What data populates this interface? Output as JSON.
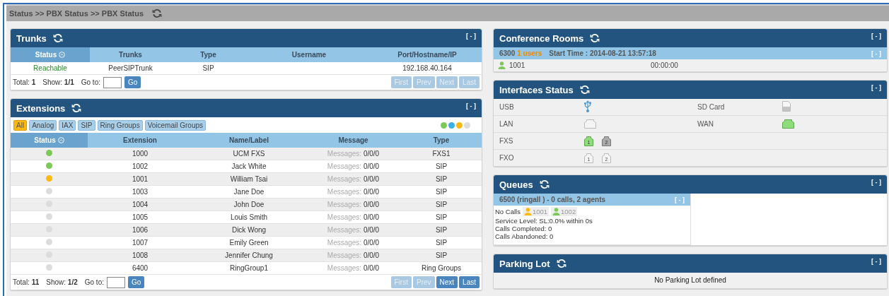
{
  "breadcrumb": "Status >> PBX Status >> PBX Status",
  "trunks": {
    "title": "Trunks",
    "collapse": "[ - ]",
    "columns": [
      {
        "label": "Status",
        "sorted": true
      },
      {
        "label": "Trunks",
        "sorted": false
      },
      {
        "label": "Type",
        "sorted": false
      },
      {
        "label": "Username",
        "sorted": false
      },
      {
        "label": "Port/Hostname/IP",
        "sorted": false
      }
    ],
    "rows": [
      {
        "status": "Reachable",
        "trunk": "PeerSIPTrunk",
        "type": "SIP",
        "host": "192.168.40.164"
      }
    ],
    "pager": {
      "total": "Total: **1**",
      "show": "Show: **1/1**",
      "goto": "Go to:",
      "go": "Go",
      "buttons": [
        {
          "label": "First",
          "disabled": true
        },
        {
          "label": "Prev",
          "disabled": true
        },
        {
          "label": "Next",
          "disabled": true
        },
        {
          "label": "Last",
          "disabled": true
        }
      ]
    }
  },
  "extensions": {
    "title": "Extensions",
    "collapse": "[ - ]",
    "filters": [
      {
        "label": "All",
        "selected": true
      },
      {
        "label": "Analog",
        "selected": false
      },
      {
        "label": "IAX",
        "selected": false
      },
      {
        "label": "SIP",
        "selected": false
      },
      {
        "label": "Ring Groups",
        "selected": false
      },
      {
        "label": "Voicemail Groups",
        "selected": false
      }
    ],
    "legend": [
      {
        "color": "#7dc957"
      },
      {
        "color": "#3bb0e6"
      },
      {
        "color": "#fdb913"
      },
      {
        "color": "#dcdcdc"
      }
    ],
    "columns": [
      {
        "label": "Status",
        "sorted": true
      },
      {
        "label": "Extension",
        "sorted": false
      },
      {
        "label": "Name/Label",
        "sorted": false
      },
      {
        "label": "Message",
        "sorted": false
      },
      {
        "label": "Type",
        "sorted": false
      }
    ],
    "rows": [
      {
        "color": "#7dc957",
        "extension": "1000",
        "name": "UCM FXS",
        "message_label": "Messages:",
        "message": "0/0/0",
        "type": "FXS1"
      },
      {
        "color": "#7dc957",
        "extension": "1002",
        "name": "Jack White",
        "message_label": "Messages:",
        "message": "0/0/0",
        "type": "SIP"
      },
      {
        "color": "#fdb913",
        "extension": "1001",
        "name": "William Tsai",
        "message_label": "Messages:",
        "message": "0/0/0",
        "type": "SIP"
      },
      {
        "color": "#dcdcdc",
        "extension": "1003",
        "name": "Jane Doe",
        "message_label": "Messages:",
        "message": "0/0/0",
        "type": "SIP"
      },
      {
        "color": "#dcdcdc",
        "extension": "1004",
        "name": "John Doe",
        "message_label": "Messages:",
        "message": "0/0/0",
        "type": "SIP"
      },
      {
        "color": "#dcdcdc",
        "extension": "1005",
        "name": "Louis Smith",
        "message_label": "Messages:",
        "message": "0/0/0",
        "type": "SIP"
      },
      {
        "color": "#dcdcdc",
        "extension": "1006",
        "name": "Dick Wong",
        "message_label": "Messages:",
        "message": "0/0/0",
        "type": "SIP"
      },
      {
        "color": "#dcdcdc",
        "extension": "1007",
        "name": "Emily Green",
        "message_label": "Messages:",
        "message": "0/0/0",
        "type": "SIP"
      },
      {
        "color": "#dcdcdc",
        "extension": "1008",
        "name": "Jennifer Chung",
        "message_label": "Messages:",
        "message": "0/0/0",
        "type": "SIP"
      },
      {
        "color": "#dcdcdc",
        "extension": "6400",
        "name": "RingGroup1",
        "message_label": "Messages:",
        "message": "0/0/0",
        "type": "Ring Groups"
      }
    ],
    "pager": {
      "total": "Total: **11**",
      "show": "Show: **1/2**",
      "goto": "Go to:",
      "go": "Go",
      "buttons": [
        {
          "label": "First",
          "disabled": true
        },
        {
          "label": "Prev",
          "disabled": true
        },
        {
          "label": "Next",
          "disabled": false
        },
        {
          "label": "Last",
          "disabled": false
        }
      ]
    }
  },
  "conference": {
    "title": "Conference Rooms",
    "collapse": "[ - ]",
    "room": {
      "number": "6300",
      "users": "1 users",
      "start": "Start Time : 2014-08-21 13:57:18",
      "collapse": "[ - ]"
    },
    "members": [
      {
        "extension": "1001",
        "time": "00:00:00",
        "color": "#7dc957"
      }
    ]
  },
  "interfaces": {
    "title": "Interfaces Status",
    "collapse": "[ - ]",
    "rows": [
      [
        {
          "label": "USB",
          "kind": "usb"
        },
        {
          "label": "SD Card",
          "kind": "sd"
        }
      ],
      [
        {
          "label": "LAN",
          "kind": "port",
          "ports": [
            {
              "connected": false,
              "busy": false
            }
          ]
        },
        {
          "label": "WAN",
          "kind": "port",
          "ports": [
            {
              "connected": true,
              "busy": false
            }
          ]
        }
      ],
      [
        {
          "label": "FXS",
          "kind": "port",
          "ports": [
            {
              "label": "1",
              "connected": true,
              "busy": false
            },
            {
              "label": "2",
              "connected": false,
              "busy": true
            }
          ]
        }
      ],
      [
        {
          "label": "FXO",
          "kind": "port",
          "ports": [
            {
              "label": "1",
              "connected": false,
              "busy": false
            },
            {
              "label": "2",
              "connected": false,
              "busy": false
            }
          ]
        }
      ]
    ]
  },
  "queues": {
    "title": "Queues",
    "collapse": "[ - ]",
    "queue": {
      "title": "6500 (ringall ) - 0 calls, 2 agents",
      "collapse": "[ - ]",
      "calls": "No Calls",
      "agents": [
        {
          "extension": "1001",
          "color": "#fdb913"
        },
        {
          "extension": "1002",
          "color": "#7dc957"
        }
      ],
      "stats": [
        "Service Level: SL:0.0% within 0s",
        "Calls Completed: 0",
        "Calls Abandoned: 0"
      ]
    }
  },
  "parking": {
    "title": "Parking Lot",
    "collapse": "[ - ]",
    "message": "No Parking Lot defined"
  }
}
